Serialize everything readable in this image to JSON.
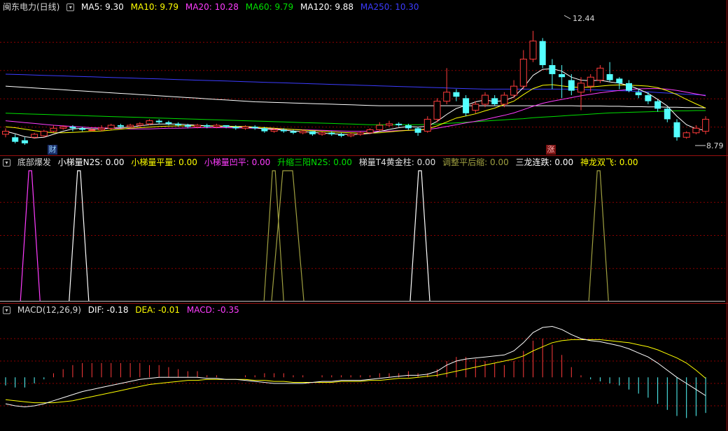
{
  "main_header": {
    "title": "闽东电力(日线)",
    "ma5": "MA5: 9.30",
    "ma10": "MA10: 9.79",
    "ma20": "MA20: 10.28",
    "ma60": "MA60: 9.79",
    "ma120": "MA120: 9.88",
    "ma250": "MA250: 10.30"
  },
  "ind_header": {
    "name": "底部爆发",
    "items": [
      "小梯量N2S: 0.00",
      "小梯量平量: 0.00",
      "小梯量凹平: 0.00",
      "升缩三阳N2S: 0.00",
      "梯量T4黄金柱: 0.00",
      "调整平后缩: 0.00",
      "三龙连跌: 0.00",
      "神龙双飞: 0.00"
    ]
  },
  "macd_header": {
    "name": "MACD(12,26,9)",
    "dif": "DIF: -0.18",
    "dea": "DEA: -0.01",
    "macd": "MACD: -0.35"
  },
  "markers": {
    "cai": "财",
    "zhang": "涨"
  },
  "annotations": {
    "high": "12.44",
    "low": "8.79"
  },
  "colors": {
    "up": "#ff3b3b",
    "down": "#54ffff",
    "ma5": "#ffffff",
    "ma10": "#ffff00",
    "ma20": "#ff3cff",
    "ma60": "#00e000",
    "ma120": "#ffffff",
    "ma250": "#3c3cff",
    "grid": "#8b0000",
    "olive": "#a0a040"
  },
  "chart_data": {
    "type": "candlestick",
    "price": {
      "ylim": [
        8.3,
        13.0
      ],
      "candles": [
        [
          9.0,
          9.1,
          9.2,
          8.9
        ],
        [
          8.9,
          8.75,
          9.0,
          8.7
        ],
        [
          8.8,
          8.7,
          8.9,
          8.65
        ],
        [
          8.9,
          9.0,
          9.05,
          8.85
        ],
        [
          8.95,
          9.1,
          9.15,
          8.9
        ],
        [
          9.1,
          9.2,
          9.3,
          9.05
        ],
        [
          9.2,
          9.25,
          9.3,
          9.15
        ],
        [
          9.25,
          9.2,
          9.3,
          9.1
        ],
        [
          9.2,
          9.15,
          9.25,
          9.1
        ],
        [
          9.15,
          9.15,
          9.2,
          9.1
        ],
        [
          9.15,
          9.2,
          9.3,
          9.1
        ],
        [
          9.2,
          9.3,
          9.35,
          9.15
        ],
        [
          9.3,
          9.25,
          9.35,
          9.2
        ],
        [
          9.25,
          9.3,
          9.35,
          9.2
        ],
        [
          9.3,
          9.35,
          9.4,
          9.25
        ],
        [
          9.35,
          9.45,
          9.5,
          9.3
        ],
        [
          9.45,
          9.4,
          9.5,
          9.35
        ],
        [
          9.4,
          9.35,
          9.45,
          9.3
        ],
        [
          9.35,
          9.3,
          9.4,
          9.25
        ],
        [
          9.3,
          9.25,
          9.35,
          9.2
        ],
        [
          9.25,
          9.3,
          9.35,
          9.2
        ],
        [
          9.3,
          9.25,
          9.35,
          9.2
        ],
        [
          9.25,
          9.3,
          9.35,
          9.2
        ],
        [
          9.3,
          9.25,
          9.3,
          9.2
        ],
        [
          9.25,
          9.2,
          9.3,
          9.15
        ],
        [
          9.2,
          9.25,
          9.3,
          9.15
        ],
        [
          9.25,
          9.2,
          9.3,
          9.15
        ],
        [
          9.2,
          9.1,
          9.25,
          9.05
        ],
        [
          9.1,
          9.15,
          9.2,
          9.05
        ],
        [
          9.15,
          9.1,
          9.2,
          9.05
        ],
        [
          9.1,
          9.05,
          9.15,
          9.0
        ],
        [
          9.05,
          9.1,
          9.15,
          9.0
        ],
        [
          9.1,
          9.0,
          9.1,
          8.95
        ],
        [
          9.0,
          9.05,
          9.1,
          8.95
        ],
        [
          9.05,
          9.0,
          9.1,
          8.95
        ],
        [
          9.0,
          8.95,
          9.05,
          8.9
        ],
        [
          8.95,
          9.0,
          9.05,
          8.9
        ],
        [
          9.0,
          9.05,
          9.1,
          8.95
        ],
        [
          9.05,
          9.15,
          9.2,
          9.0
        ],
        [
          9.15,
          9.3,
          9.4,
          9.1
        ],
        [
          9.3,
          9.35,
          9.45,
          9.25
        ],
        [
          9.35,
          9.3,
          9.4,
          9.25
        ],
        [
          9.3,
          9.2,
          9.35,
          9.15
        ],
        [
          9.2,
          9.05,
          9.25,
          8.95
        ],
        [
          9.1,
          9.5,
          9.6,
          9.05
        ],
        [
          9.5,
          10.1,
          10.2,
          9.4
        ],
        [
          10.1,
          10.4,
          11.2,
          10.0
        ],
        [
          10.4,
          10.25,
          10.5,
          10.1
        ],
        [
          10.2,
          9.7,
          10.3,
          9.6
        ],
        [
          9.8,
          10.0,
          10.1,
          9.7
        ],
        [
          10.0,
          10.3,
          10.4,
          9.9
        ],
        [
          10.2,
          10.0,
          10.3,
          9.95
        ],
        [
          10.0,
          10.3,
          10.4,
          9.9
        ],
        [
          10.3,
          10.6,
          10.8,
          10.2
        ],
        [
          10.6,
          11.5,
          11.8,
          10.5
        ],
        [
          11.5,
          12.1,
          12.44,
          11.4
        ],
        [
          12.1,
          11.3,
          12.2,
          11.2
        ],
        [
          11.3,
          11.0,
          11.5,
          10.5
        ],
        [
          11.0,
          10.9,
          11.3,
          10.2
        ],
        [
          10.8,
          10.45,
          11.0,
          10.3
        ],
        [
          10.4,
          10.7,
          10.9,
          9.8
        ],
        [
          10.6,
          10.9,
          11.0,
          10.4
        ],
        [
          10.8,
          11.2,
          11.3,
          10.7
        ],
        [
          11.0,
          10.8,
          11.4,
          10.75
        ],
        [
          10.85,
          10.7,
          10.9,
          10.5
        ],
        [
          10.7,
          10.45,
          10.8,
          10.4
        ],
        [
          10.4,
          10.3,
          10.5,
          10.2
        ],
        [
          10.3,
          10.1,
          10.4,
          10.0
        ],
        [
          10.1,
          9.85,
          10.15,
          9.75
        ],
        [
          9.85,
          9.5,
          9.9,
          9.4
        ],
        [
          9.4,
          8.9,
          9.5,
          8.79
        ],
        [
          8.9,
          9.05,
          9.1,
          8.85
        ],
        [
          9.05,
          9.2,
          9.3,
          9.0
        ],
        [
          9.1,
          9.5,
          9.6,
          9.0
        ]
      ],
      "ma5": [
        9.1,
        9.02,
        8.92,
        8.88,
        8.9,
        9.0,
        9.1,
        9.18,
        9.2,
        9.18,
        9.18,
        9.2,
        9.22,
        9.24,
        9.28,
        9.32,
        9.34,
        9.34,
        9.34,
        9.32,
        9.3,
        9.28,
        9.26,
        9.26,
        9.24,
        9.24,
        9.22,
        9.18,
        9.16,
        9.14,
        9.11,
        9.09,
        9.06,
        9.04,
        9.02,
        9.0,
        8.99,
        9.0,
        9.03,
        9.09,
        9.16,
        9.22,
        9.26,
        9.24,
        9.27,
        9.43,
        9.66,
        9.86,
        9.96,
        10.08,
        10.14,
        10.09,
        10.12,
        10.24,
        10.56,
        10.96,
        11.16,
        11.18,
        11.1,
        10.9,
        10.8,
        10.78,
        10.8,
        10.74,
        10.7,
        10.62,
        10.5,
        10.36,
        10.16,
        9.94,
        9.6,
        9.32,
        9.18,
        9.13
      ],
      "ma10": [
        9.25,
        9.22,
        9.17,
        9.12,
        9.08,
        9.05,
        9.05,
        9.06,
        9.08,
        9.1,
        9.11,
        9.14,
        9.17,
        9.2,
        9.22,
        9.24,
        9.26,
        9.27,
        9.28,
        9.28,
        9.28,
        9.28,
        9.28,
        9.27,
        9.26,
        9.26,
        9.24,
        9.22,
        9.2,
        9.18,
        9.16,
        9.14,
        9.12,
        9.1,
        9.08,
        9.06,
        9.05,
        9.04,
        9.04,
        9.05,
        9.08,
        9.11,
        9.13,
        9.14,
        9.18,
        9.28,
        9.41,
        9.54,
        9.61,
        9.68,
        9.78,
        9.87,
        9.99,
        10.1,
        10.32,
        10.52,
        10.63,
        10.65,
        10.61,
        10.57,
        10.56,
        10.57,
        10.6,
        10.63,
        10.64,
        10.63,
        10.62,
        10.6,
        10.55,
        10.45,
        10.32,
        10.16,
        10.01,
        9.87
      ],
      "ma20": [
        9.45,
        9.42,
        9.39,
        9.36,
        9.33,
        9.3,
        9.28,
        9.26,
        9.24,
        9.22,
        9.21,
        9.2,
        9.19,
        9.18,
        9.18,
        9.18,
        9.19,
        9.2,
        9.2,
        9.21,
        9.22,
        9.22,
        9.22,
        9.22,
        9.21,
        9.21,
        9.2,
        9.19,
        9.18,
        9.17,
        9.16,
        9.15,
        9.14,
        9.13,
        9.12,
        9.11,
        9.1,
        9.1,
        9.1,
        9.1,
        9.11,
        9.12,
        9.13,
        9.14,
        9.16,
        9.2,
        9.26,
        9.32,
        9.38,
        9.43,
        9.49,
        9.56,
        9.63,
        9.71,
        9.82,
        9.93,
        10.03,
        10.1,
        10.16,
        10.22,
        10.28,
        10.33,
        10.38,
        10.42,
        10.46,
        10.49,
        10.51,
        10.52,
        10.52,
        10.5,
        10.46,
        10.4,
        10.34,
        10.28
      ],
      "ma60": [
        9.7,
        9.69,
        9.68,
        9.67,
        9.66,
        9.65,
        9.64,
        9.63,
        9.62,
        9.61,
        9.6,
        9.59,
        9.58,
        9.57,
        9.56,
        9.55,
        9.54,
        9.53,
        9.52,
        9.51,
        9.5,
        9.49,
        9.48,
        9.47,
        9.46,
        9.45,
        9.44,
        9.43,
        9.42,
        9.41,
        9.4,
        9.39,
        9.38,
        9.37,
        9.36,
        9.35,
        9.34,
        9.33,
        9.32,
        9.32,
        9.32,
        9.32,
        9.32,
        9.32,
        9.33,
        9.34,
        9.36,
        9.38,
        9.4,
        9.42,
        9.44,
        9.46,
        9.48,
        9.5,
        9.52,
        9.55,
        9.57,
        9.59,
        9.61,
        9.63,
        9.65,
        9.67,
        9.69,
        9.71,
        9.72,
        9.73,
        9.74,
        9.75,
        9.76,
        9.77,
        9.78,
        9.78,
        9.79,
        9.79
      ],
      "ma120": [
        10.6,
        10.58,
        10.56,
        10.54,
        10.52,
        10.5,
        10.48,
        10.46,
        10.44,
        10.42,
        10.4,
        10.38,
        10.36,
        10.34,
        10.32,
        10.3,
        10.28,
        10.26,
        10.24,
        10.22,
        10.2,
        10.18,
        10.16,
        10.14,
        10.12,
        10.1,
        10.08,
        10.07,
        10.06,
        10.05,
        10.04,
        10.03,
        10.02,
        10.01,
        10.0,
        9.99,
        9.98,
        9.97,
        9.96,
        9.95,
        9.95,
        9.95,
        9.95,
        9.95,
        9.95,
        9.95,
        9.95,
        9.95,
        9.95,
        9.95,
        9.95,
        9.95,
        9.95,
        9.95,
        9.95,
        9.95,
        9.95,
        9.95,
        9.95,
        9.95,
        9.94,
        9.94,
        9.94,
        9.93,
        9.93,
        9.92,
        9.92,
        9.91,
        9.91,
        9.9,
        9.9,
        9.89,
        9.89,
        9.88
      ],
      "ma250": [
        11.0,
        10.99,
        10.98,
        10.97,
        10.96,
        10.95,
        10.94,
        10.93,
        10.92,
        10.91,
        10.9,
        10.89,
        10.88,
        10.87,
        10.86,
        10.85,
        10.84,
        10.83,
        10.82,
        10.81,
        10.8,
        10.79,
        10.78,
        10.77,
        10.76,
        10.75,
        10.74,
        10.73,
        10.72,
        10.71,
        10.7,
        10.69,
        10.68,
        10.67,
        10.66,
        10.65,
        10.64,
        10.63,
        10.62,
        10.61,
        10.6,
        10.59,
        10.58,
        10.57,
        10.56,
        10.55,
        10.54,
        10.53,
        10.52,
        10.51,
        10.5,
        10.5,
        10.5,
        10.5,
        10.5,
        10.5,
        10.5,
        10.5,
        10.5,
        10.5,
        10.49,
        10.48,
        10.47,
        10.46,
        10.45,
        10.44,
        10.43,
        10.41,
        10.39,
        10.37,
        10.35,
        10.33,
        10.32,
        10.3
      ]
    },
    "indicator": {
      "ylim": [
        0,
        1
      ],
      "spikes": [
        [
          1,
          "ma20"
        ],
        [
          4,
          "ma5"
        ],
        [
          16,
          "olive"
        ],
        [
          25,
          "ma5"
        ],
        [
          36,
          "olive"
        ]
      ]
    },
    "macd": {
      "ylim": [
        -0.5,
        0.6
      ],
      "dif": [
        -0.26,
        -0.28,
        -0.29,
        -0.28,
        -0.26,
        -0.23,
        -0.2,
        -0.17,
        -0.14,
        -0.12,
        -0.1,
        -0.08,
        -0.06,
        -0.04,
        -0.02,
        -0.01,
        0.0,
        0.0,
        0.0,
        0.0,
        0.0,
        -0.01,
        -0.01,
        -0.02,
        -0.02,
        -0.03,
        -0.04,
        -0.05,
        -0.06,
        -0.06,
        -0.06,
        -0.06,
        -0.05,
        -0.04,
        -0.04,
        -0.03,
        -0.03,
        -0.03,
        -0.02,
        -0.01,
        0.0,
        0.01,
        0.02,
        0.02,
        0.03,
        0.06,
        0.12,
        0.16,
        0.18,
        0.19,
        0.2,
        0.21,
        0.22,
        0.26,
        0.34,
        0.44,
        0.49,
        0.5,
        0.47,
        0.42,
        0.38,
        0.36,
        0.35,
        0.33,
        0.31,
        0.28,
        0.24,
        0.2,
        0.14,
        0.07,
        0.0,
        -0.06,
        -0.12,
        -0.18
      ],
      "dea": [
        -0.22,
        -0.23,
        -0.24,
        -0.25,
        -0.25,
        -0.25,
        -0.24,
        -0.23,
        -0.21,
        -0.19,
        -0.17,
        -0.15,
        -0.13,
        -0.11,
        -0.09,
        -0.07,
        -0.06,
        -0.05,
        -0.04,
        -0.03,
        -0.03,
        -0.02,
        -0.02,
        -0.02,
        -0.02,
        -0.02,
        -0.03,
        -0.03,
        -0.04,
        -0.04,
        -0.05,
        -0.05,
        -0.05,
        -0.05,
        -0.05,
        -0.04,
        -0.04,
        -0.04,
        -0.03,
        -0.03,
        -0.02,
        -0.01,
        -0.01,
        0.0,
        0.01,
        0.02,
        0.04,
        0.06,
        0.08,
        0.1,
        0.12,
        0.14,
        0.16,
        0.18,
        0.21,
        0.26,
        0.3,
        0.34,
        0.36,
        0.37,
        0.37,
        0.37,
        0.37,
        0.36,
        0.35,
        0.34,
        0.32,
        0.3,
        0.27,
        0.23,
        0.19,
        0.14,
        0.07,
        -0.01
      ],
      "macd": [
        -0.08,
        -0.1,
        -0.1,
        -0.06,
        -0.02,
        0.04,
        0.08,
        0.12,
        0.14,
        0.14,
        0.14,
        0.14,
        0.14,
        0.14,
        0.14,
        0.12,
        0.12,
        0.1,
        0.08,
        0.06,
        0.06,
        0.02,
        0.02,
        0.0,
        0.0,
        0.02,
        0.02,
        0.04,
        0.04,
        0.04,
        0.02,
        0.02,
        0.0,
        0.02,
        0.02,
        0.02,
        0.02,
        0.02,
        0.02,
        0.04,
        0.04,
        0.04,
        0.06,
        0.04,
        0.04,
        0.08,
        0.16,
        0.2,
        0.2,
        0.18,
        0.16,
        0.14,
        0.12,
        0.16,
        0.26,
        0.36,
        0.38,
        0.32,
        0.22,
        0.1,
        0.02,
        -0.02,
        -0.04,
        -0.06,
        -0.08,
        -0.12,
        -0.16,
        -0.2,
        -0.26,
        -0.32,
        -0.38,
        -0.4,
        -0.38,
        -0.35
      ]
    }
  }
}
